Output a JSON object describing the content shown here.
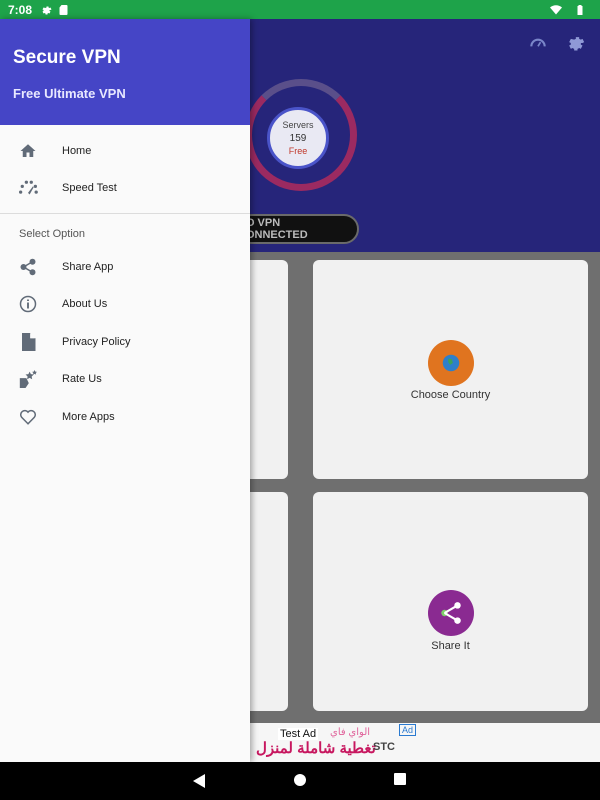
{
  "status_bar": {
    "time": "7:08"
  },
  "app": {
    "gauge": {
      "servers_label": "Servers",
      "server_count": "159",
      "tier": "Free"
    },
    "connection_status": "NO VPN CONNECTED",
    "cards": [
      {
        "label": "Choose Country",
        "color": "#e0741f"
      },
      {
        "label": "Share It",
        "color": "#8a2a91"
      }
    ],
    "ad": {
      "test_label": "Test Ad",
      "arabic_top": "الواي فاي",
      "arabic_main": "تغطية شاملة لمنزل",
      "badge": "Ad",
      "brand": "STC"
    }
  },
  "drawer": {
    "title": "Secure VPN",
    "subtitle": "Free Ultimate VPN",
    "primary_items": [
      {
        "label": "Home",
        "icon": "home-icon"
      },
      {
        "label": "Speed Test",
        "icon": "speedometer-icon"
      }
    ],
    "section_label": "Select Option",
    "secondary_items": [
      {
        "label": "Share App",
        "icon": "share-icon"
      },
      {
        "label": "About Us",
        "icon": "info-icon"
      },
      {
        "label": "Privacy Policy",
        "icon": "document-icon"
      },
      {
        "label": "Rate Us",
        "icon": "rate-icon"
      },
      {
        "label": "More Apps",
        "icon": "heart-icon"
      }
    ]
  },
  "colors": {
    "status_bar": "#1ea34a",
    "drawer_header": "#4545c6",
    "app_header": "#26257a",
    "icon_gray": "#616b78"
  }
}
